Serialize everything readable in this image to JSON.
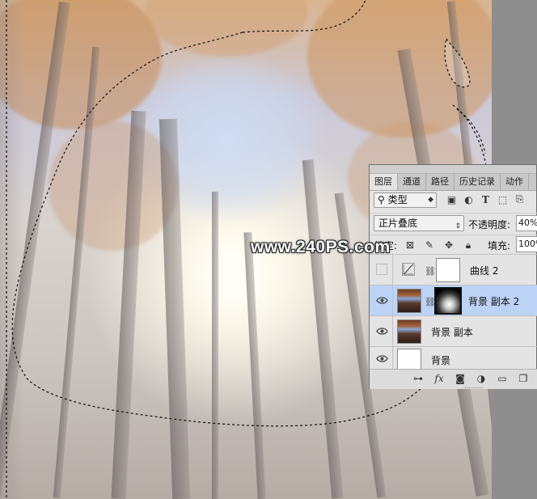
{
  "watermark": "www.240PS.com",
  "panel": {
    "tabs": [
      "图层",
      "通道",
      "路径",
      "历史记录",
      "动作"
    ],
    "filter": {
      "kind_label": "类型",
      "kind_icon": "search-icon"
    },
    "blend_mode": "正片叠底",
    "opacity_label": "不透明度:",
    "opacity_value": "40%",
    "lock_label": "锁定:",
    "fill_label": "填充:",
    "fill_value": "100%",
    "layers": [
      {
        "name": "曲线 2",
        "visible": false,
        "type": "adjustment",
        "selected": false
      },
      {
        "name": "背景 副本 2",
        "visible": true,
        "type": "image-with-mask",
        "selected": true
      },
      {
        "name": "背景 副本",
        "visible": true,
        "type": "image",
        "selected": false
      },
      {
        "name": "背景",
        "visible": true,
        "type": "fill-white",
        "selected": false
      }
    ],
    "footer_icons": [
      "link-icon",
      "fx-icon",
      "mask-icon",
      "adjustment-icon",
      "folder-icon",
      "new-layer-icon"
    ]
  }
}
